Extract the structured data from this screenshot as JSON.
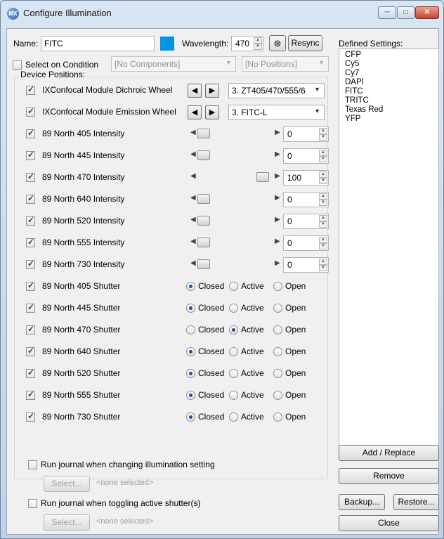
{
  "window": {
    "title": "Configure Illumination",
    "icon_text": "MX"
  },
  "name_label": "Name:",
  "name_value": "FITC",
  "color_swatch": "#0095e0",
  "wavelength_label": "Wavelength:",
  "wavelength_value": "470",
  "resync_label": "Resync",
  "select_on_condition_label": "Select on Condition",
  "components_placeholder": "[No Components]",
  "positions_placeholder": "[No Positions]",
  "device_positions_label": "Device Positions:",
  "wheels": [
    {
      "label": "IXConfocal Module Dichroic Wheel",
      "value": "3. ZT405/470/555/6"
    },
    {
      "label": "IXConfocal Module Emission Wheel",
      "value": "3. FITC-L"
    }
  ],
  "intensities": [
    {
      "label": "89 North 405 Intensity",
      "value": "0",
      "level": 0
    },
    {
      "label": "89 North 445 Intensity",
      "value": "0",
      "level": 0
    },
    {
      "label": "89 North 470 Intensity",
      "value": "100",
      "level": 1
    },
    {
      "label": "89 North 640 Intensity",
      "value": "0",
      "level": 0
    },
    {
      "label": "89 North 520 Intensity",
      "value": "0",
      "level": 0
    },
    {
      "label": "89 North 555 Intensity",
      "value": "0",
      "level": 0
    },
    {
      "label": "89 North 730 Intensity",
      "value": "0",
      "level": 0
    }
  ],
  "shutter_options": [
    "Closed",
    "Active",
    "Open"
  ],
  "shutters": [
    {
      "label": "89 North 405 Shutter",
      "selected": "Closed"
    },
    {
      "label": "89 North 445 Shutter",
      "selected": "Closed"
    },
    {
      "label": "89 North 470 Shutter",
      "selected": "Active"
    },
    {
      "label": "89 North 640 Shutter",
      "selected": "Closed"
    },
    {
      "label": "89 North 520 Shutter",
      "selected": "Closed"
    },
    {
      "label": "89 North 555 Shutter",
      "selected": "Closed"
    },
    {
      "label": "89 North 730 Shutter",
      "selected": "Closed"
    }
  ],
  "journal_change_label": "Run journal when changing illumination setting",
  "journal_toggle_label": "Run journal when toggling active shutter(s)",
  "select_label": "Select...",
  "none_selected": "<none selected>",
  "defined_settings_label": "Defined Settings:",
  "defined_settings": [
    "CFP",
    "Cy5",
    "Cy7",
    "DAPI",
    "FITC",
    "TRITC",
    "Texas Red",
    "YFP"
  ],
  "buttons": {
    "add_replace": "Add / Replace",
    "remove": "Remove",
    "backup": "Backup...",
    "restore": "Restore...",
    "close": "Close"
  }
}
